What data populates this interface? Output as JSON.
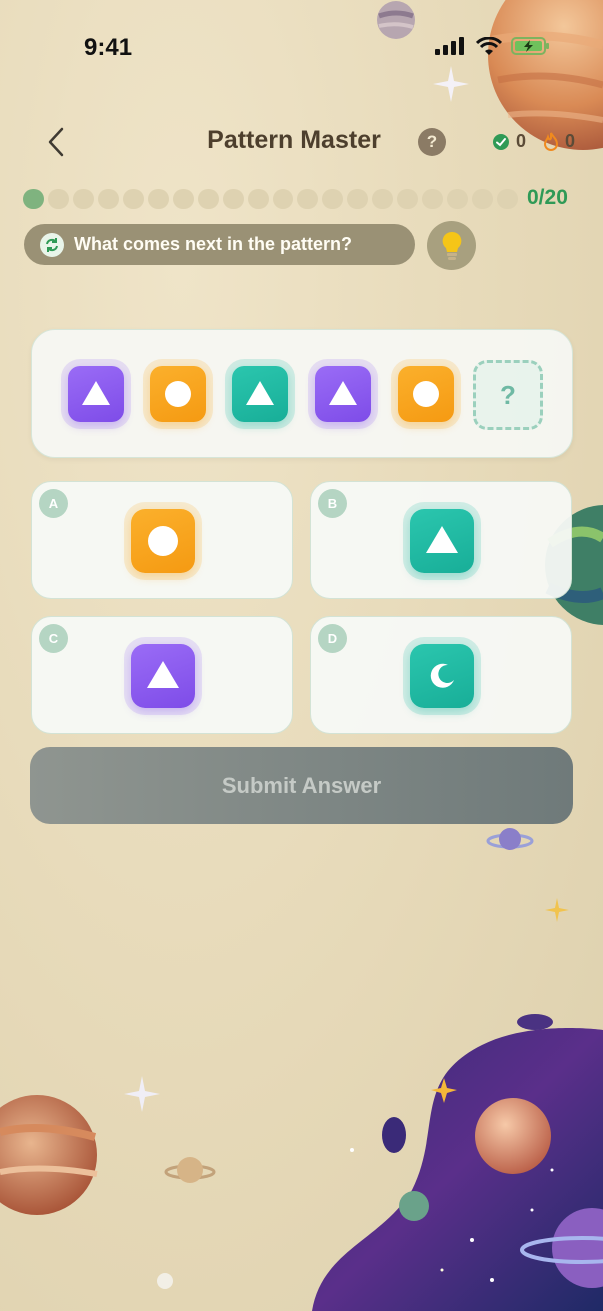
{
  "status_bar": {
    "time": "9:41"
  },
  "header": {
    "title": "Pattern Master",
    "help_label": "?",
    "correct_count": "0",
    "streak_count": "0"
  },
  "progress": {
    "current": 0,
    "total": 20,
    "label": "0/20"
  },
  "prompt": {
    "text": "What comes next in the pattern?"
  },
  "pattern": {
    "tiles": [
      {
        "color": "purple",
        "shape": "triangle"
      },
      {
        "color": "orange",
        "shape": "circle"
      },
      {
        "color": "teal",
        "shape": "triangle"
      },
      {
        "color": "purple",
        "shape": "triangle"
      },
      {
        "color": "orange",
        "shape": "circle"
      }
    ],
    "missing_label": "?"
  },
  "options": [
    {
      "letter": "A",
      "color": "orange",
      "shape": "circle"
    },
    {
      "letter": "B",
      "color": "teal",
      "shape": "triangle"
    },
    {
      "letter": "C",
      "color": "purple",
      "shape": "triangle"
    },
    {
      "letter": "D",
      "color": "teal",
      "shape": "moon"
    }
  ],
  "submit": {
    "label": "Submit Answer"
  },
  "colors": {
    "purple": "#8b5cf6",
    "orange": "#f8a51f",
    "teal": "#20b8a2",
    "accent_green": "#2f9a56"
  }
}
